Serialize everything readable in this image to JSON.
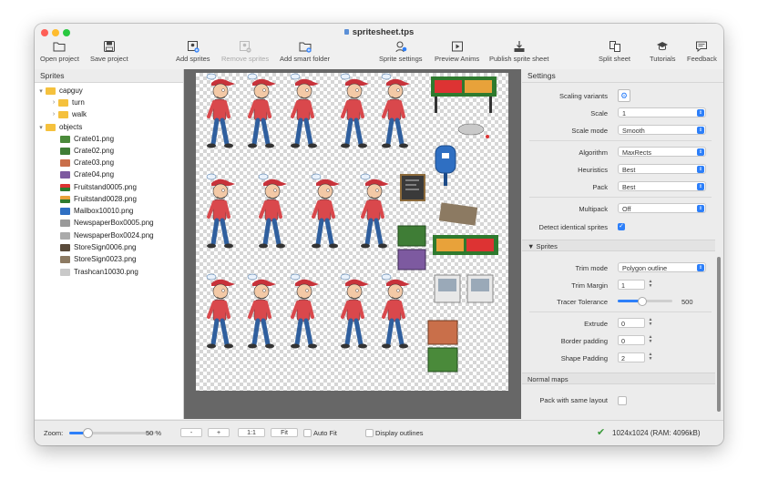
{
  "window": {
    "title": "spritesheet.tps"
  },
  "toolbar": {
    "open_project": "Open project",
    "save_project": "Save project",
    "add_sprites": "Add sprites",
    "remove_sprites": "Remove sprites",
    "add_smart_folder": "Add smart folder",
    "sprite_settings": "Sprite settings",
    "preview_anims": "Preview Anims",
    "publish_sprite_sheet": "Publish sprite sheet",
    "split_sheet": "Split sheet",
    "tutorials": "Tutorials",
    "feedback": "Feedback"
  },
  "sprites_panel": {
    "title": "Sprites",
    "tree": {
      "capguy": "capguy",
      "turn": "turn",
      "walk": "walk",
      "objects": "objects",
      "files": [
        "Crate01.png",
        "Crate02.png",
        "Crate03.png",
        "Crate04.png",
        "Fruitstand0005.png",
        "Fruitstand0028.png",
        "Mailbox10010.png",
        "NewspaperBox0005.png",
        "NewspaperBox0024.png",
        "StoreSign0006.png",
        "StoreSign0023.png",
        "Trashcan10030.png"
      ]
    }
  },
  "settings": {
    "title": "Settings",
    "scaling_variants_label": "Scaling variants",
    "scale_label": "Scale",
    "scale_value": "1",
    "scale_mode_label": "Scale mode",
    "scale_mode_value": "Smooth",
    "algorithm_label": "Algorithm",
    "algorithm_value": "MaxRects",
    "heuristics_label": "Heuristics",
    "heuristics_value": "Best",
    "pack_label": "Pack",
    "pack_value": "Best",
    "multipack_label": "Multipack",
    "multipack_value": "Off",
    "detect_identical_label": "Detect identical sprites",
    "detect_identical_checked": true,
    "sprites_section": "Sprites",
    "trim_mode_label": "Trim mode",
    "trim_mode_value": "Polygon outline",
    "trim_margin_label": "Trim Margin",
    "trim_margin_value": "1",
    "tracer_tolerance_label": "Tracer Tolerance",
    "tracer_tolerance_value": "500",
    "tracer_tolerance_level": 0.5,
    "extrude_label": "Extrude",
    "extrude_value": "0",
    "border_padding_label": "Border padding",
    "border_padding_value": "0",
    "shape_padding_label": "Shape Padding",
    "shape_padding_value": "2",
    "normal_maps_section": "Normal maps",
    "pack_same_layout_label": "Pack with same layout",
    "pack_same_layout_checked": false
  },
  "statusbar": {
    "zoom_label": "Zoom:",
    "zoom_value": "50 %",
    "zoom_level": 0.5,
    "btn_minus": "-",
    "btn_plus": "+",
    "btn_one": "1:1",
    "btn_fit": "Fit",
    "auto_fit": "Auto Fit",
    "display_outlines": "Display outlines",
    "size_info": "1024x1024 (RAM: 4096kB)"
  },
  "colors": {
    "accent": "#2d7ff9",
    "folder": "#f5c13d",
    "shirt": "#d9484c",
    "cap": "#c8323a",
    "jeans": "#2f5f9e",
    "check_green": "#3a9a3a"
  }
}
